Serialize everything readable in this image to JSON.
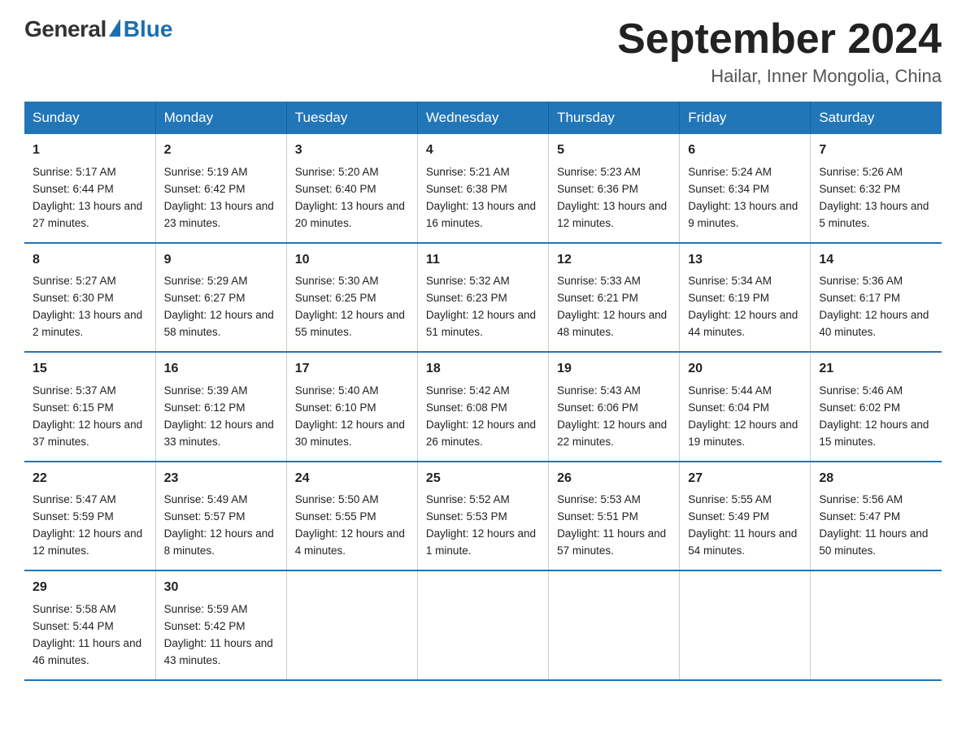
{
  "header": {
    "logo_general": "General",
    "logo_blue": "Blue",
    "month_title": "September 2024",
    "location": "Hailar, Inner Mongolia, China"
  },
  "days_of_week": [
    "Sunday",
    "Monday",
    "Tuesday",
    "Wednesday",
    "Thursday",
    "Friday",
    "Saturday"
  ],
  "weeks": [
    [
      {
        "day": "1",
        "sunrise": "5:17 AM",
        "sunset": "6:44 PM",
        "daylight": "13 hours and 27 minutes."
      },
      {
        "day": "2",
        "sunrise": "5:19 AM",
        "sunset": "6:42 PM",
        "daylight": "13 hours and 23 minutes."
      },
      {
        "day": "3",
        "sunrise": "5:20 AM",
        "sunset": "6:40 PM",
        "daylight": "13 hours and 20 minutes."
      },
      {
        "day": "4",
        "sunrise": "5:21 AM",
        "sunset": "6:38 PM",
        "daylight": "13 hours and 16 minutes."
      },
      {
        "day": "5",
        "sunrise": "5:23 AM",
        "sunset": "6:36 PM",
        "daylight": "13 hours and 12 minutes."
      },
      {
        "day": "6",
        "sunrise": "5:24 AM",
        "sunset": "6:34 PM",
        "daylight": "13 hours and 9 minutes."
      },
      {
        "day": "7",
        "sunrise": "5:26 AM",
        "sunset": "6:32 PM",
        "daylight": "13 hours and 5 minutes."
      }
    ],
    [
      {
        "day": "8",
        "sunrise": "5:27 AM",
        "sunset": "6:30 PM",
        "daylight": "13 hours and 2 minutes."
      },
      {
        "day": "9",
        "sunrise": "5:29 AM",
        "sunset": "6:27 PM",
        "daylight": "12 hours and 58 minutes."
      },
      {
        "day": "10",
        "sunrise": "5:30 AM",
        "sunset": "6:25 PM",
        "daylight": "12 hours and 55 minutes."
      },
      {
        "day": "11",
        "sunrise": "5:32 AM",
        "sunset": "6:23 PM",
        "daylight": "12 hours and 51 minutes."
      },
      {
        "day": "12",
        "sunrise": "5:33 AM",
        "sunset": "6:21 PM",
        "daylight": "12 hours and 48 minutes."
      },
      {
        "day": "13",
        "sunrise": "5:34 AM",
        "sunset": "6:19 PM",
        "daylight": "12 hours and 44 minutes."
      },
      {
        "day": "14",
        "sunrise": "5:36 AM",
        "sunset": "6:17 PM",
        "daylight": "12 hours and 40 minutes."
      }
    ],
    [
      {
        "day": "15",
        "sunrise": "5:37 AM",
        "sunset": "6:15 PM",
        "daylight": "12 hours and 37 minutes."
      },
      {
        "day": "16",
        "sunrise": "5:39 AM",
        "sunset": "6:12 PM",
        "daylight": "12 hours and 33 minutes."
      },
      {
        "day": "17",
        "sunrise": "5:40 AM",
        "sunset": "6:10 PM",
        "daylight": "12 hours and 30 minutes."
      },
      {
        "day": "18",
        "sunrise": "5:42 AM",
        "sunset": "6:08 PM",
        "daylight": "12 hours and 26 minutes."
      },
      {
        "day": "19",
        "sunrise": "5:43 AM",
        "sunset": "6:06 PM",
        "daylight": "12 hours and 22 minutes."
      },
      {
        "day": "20",
        "sunrise": "5:44 AM",
        "sunset": "6:04 PM",
        "daylight": "12 hours and 19 minutes."
      },
      {
        "day": "21",
        "sunrise": "5:46 AM",
        "sunset": "6:02 PM",
        "daylight": "12 hours and 15 minutes."
      }
    ],
    [
      {
        "day": "22",
        "sunrise": "5:47 AM",
        "sunset": "5:59 PM",
        "daylight": "12 hours and 12 minutes."
      },
      {
        "day": "23",
        "sunrise": "5:49 AM",
        "sunset": "5:57 PM",
        "daylight": "12 hours and 8 minutes."
      },
      {
        "day": "24",
        "sunrise": "5:50 AM",
        "sunset": "5:55 PM",
        "daylight": "12 hours and 4 minutes."
      },
      {
        "day": "25",
        "sunrise": "5:52 AM",
        "sunset": "5:53 PM",
        "daylight": "12 hours and 1 minute."
      },
      {
        "day": "26",
        "sunrise": "5:53 AM",
        "sunset": "5:51 PM",
        "daylight": "11 hours and 57 minutes."
      },
      {
        "day": "27",
        "sunrise": "5:55 AM",
        "sunset": "5:49 PM",
        "daylight": "11 hours and 54 minutes."
      },
      {
        "day": "28",
        "sunrise": "5:56 AM",
        "sunset": "5:47 PM",
        "daylight": "11 hours and 50 minutes."
      }
    ],
    [
      {
        "day": "29",
        "sunrise": "5:58 AM",
        "sunset": "5:44 PM",
        "daylight": "11 hours and 46 minutes."
      },
      {
        "day": "30",
        "sunrise": "5:59 AM",
        "sunset": "5:42 PM",
        "daylight": "11 hours and 43 minutes."
      },
      null,
      null,
      null,
      null,
      null
    ]
  ]
}
